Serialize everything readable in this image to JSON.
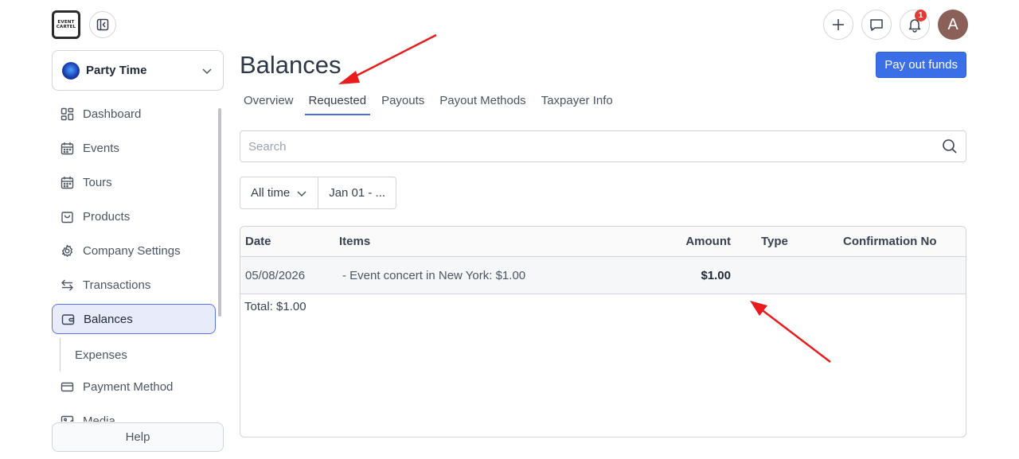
{
  "brand": {
    "logo_line1": "EVENT",
    "logo_line2": "CARTEL"
  },
  "org": {
    "name": "Party Time"
  },
  "sidebar": {
    "items": [
      {
        "label": "Dashboard",
        "icon": "dashboard-icon"
      },
      {
        "label": "Events",
        "icon": "calendar-icon"
      },
      {
        "label": "Tours",
        "icon": "calendar-icon"
      },
      {
        "label": "Products",
        "icon": "shopping-bag-icon"
      },
      {
        "label": "Company Settings",
        "icon": "gear-icon"
      },
      {
        "label": "Transactions",
        "icon": "arrows-icon"
      },
      {
        "label": "Balances",
        "icon": "wallet-icon",
        "active": true
      },
      {
        "label": "Expenses",
        "sub": true
      },
      {
        "label": "Payment Method",
        "icon": "credit-card-icon"
      },
      {
        "label": "Media",
        "icon": "image-icon"
      }
    ],
    "help_label": "Help"
  },
  "header": {
    "notification_count": "1",
    "avatar_initial": "A"
  },
  "main": {
    "title": "Balances",
    "payout_label": "Pay out funds",
    "tabs": [
      {
        "label": "Overview"
      },
      {
        "label": "Requested",
        "active": true
      },
      {
        "label": "Payouts"
      },
      {
        "label": "Payout Methods"
      },
      {
        "label": "Taxpayer Info"
      }
    ],
    "search_placeholder": "Search",
    "filters": {
      "period": "All time",
      "date_range": "Jan 01 - ..."
    },
    "table": {
      "headers": {
        "date": "Date",
        "items": "Items",
        "amount": "Amount",
        "type": "Type",
        "confirmation": "Confirmation No"
      },
      "rows": [
        {
          "date": "05/08/2026",
          "items": "- Event concert in New York: $1.00",
          "amount": "$1.00",
          "type": "",
          "confirmation": ""
        }
      ],
      "total": "Total: $1.00"
    }
  },
  "colors": {
    "accent": "#3b6fe8",
    "active_bg": "#e7ebfa",
    "annotation": "#e81c1c",
    "badge": "#e53935"
  }
}
